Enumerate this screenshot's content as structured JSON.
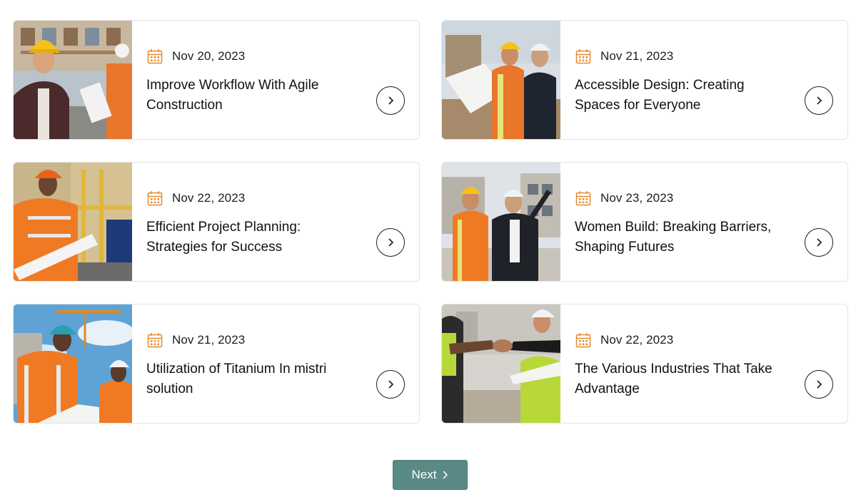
{
  "posts": [
    {
      "date": "Nov 20, 2023",
      "title": "Improve Workflow With Agile Construction",
      "image_scene": "worker-thumbs-up-hardhat"
    },
    {
      "date": "Nov 21, 2023",
      "title": "Accessible Design: Creating Spaces for Everyone",
      "image_scene": "engineers-reviewing-blueprint"
    },
    {
      "date": "Nov 22, 2023",
      "title": "Efficient Project Planning: Strategies for Success",
      "image_scene": "worker-holding-plans"
    },
    {
      "date": "Nov 23, 2023",
      "title": "Women Build: Breaking Barriers, Shaping Futures",
      "image_scene": "engineers-pointing-at-building"
    },
    {
      "date": "Nov 21, 2023",
      "title": "Utilization of Titanium In mistri solution",
      "image_scene": "workers-with-crane"
    },
    {
      "date": "Nov 22, 2023",
      "title": "The Various Industries That Take Advantage",
      "image_scene": "handshake-on-site"
    }
  ],
  "pagination": {
    "next_label": "Next"
  },
  "icons": {
    "date": "calendar-icon",
    "card_action": "chevron-right-icon",
    "next": "chevron-right-icon"
  },
  "colors": {
    "accent_orange": "#e58a2e",
    "next_button": "#5a8a86",
    "card_border": "#e3e3e3"
  }
}
